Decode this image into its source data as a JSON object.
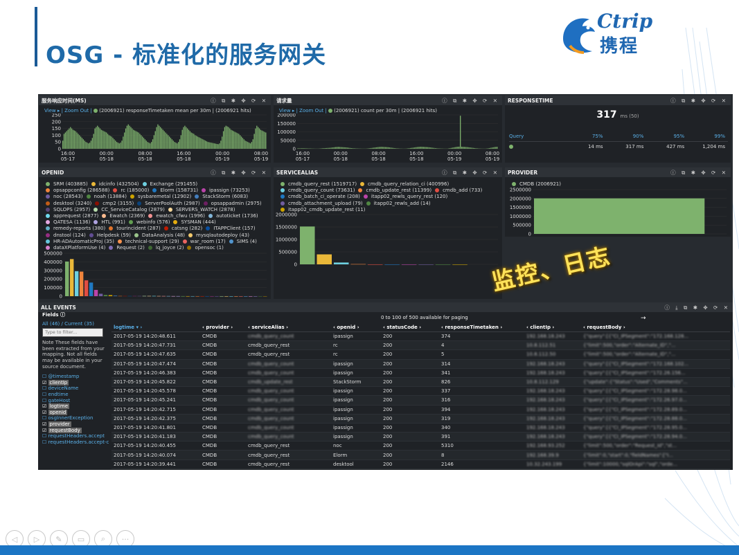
{
  "slide": {
    "title": "OSG - 标准化的服务网关",
    "logo_en": "Ctrip",
    "logo_cn": "携程",
    "overlay": "监控、日志",
    "nav_buttons": [
      "prev",
      "next",
      "pen",
      "screen",
      "zoom",
      "more"
    ]
  },
  "panels": {
    "rt_chart": {
      "title": "服务响应时间(MS)",
      "view": "View ▸ |",
      "zoom": "Zoom Out |",
      "info": "(2006921) responseTimetaken mean per 30m | (2006921 hits)"
    },
    "req_chart": {
      "title": "请求量",
      "view": "View ▸ |",
      "zoom": "Zoom Out |",
      "info": "(2006921) count per 30m | (2006921 hits)"
    },
    "responsetime": {
      "title": "RESPONSETIME",
      "value": "317",
      "unit": "ms (50)",
      "headers": [
        "Query",
        "75%",
        "90%",
        "95%",
        "99%"
      ],
      "values": [
        "14 ms",
        "317 ms",
        "427 ms",
        "1,204 ms"
      ]
    },
    "openid": {
      "title": "OPENID"
    },
    "servicealias": {
      "title": "SERVICEALIAS"
    },
    "provider": {
      "title": "PROVIDER",
      "legend": "CMDB (2006921)"
    },
    "events": {
      "title": "ALL EVENTS",
      "fields_label": "Fields",
      "fields_all": "All (46) / Current (35)",
      "filter_placeholder": "Type to filter...",
      "note": "Note These fields have been extracted from your mapping. Not all fields may be available in your source document.",
      "paging": "0 to 100 of 500 available for paging",
      "arrow": "→"
    }
  },
  "chart_data": [
    {
      "type": "bar",
      "title": "服务响应时间(MS)",
      "x_ticks": [
        "16:00\n05-17",
        "00:00\n05-18",
        "08:00\n05-18",
        "16:00\n05-18",
        "00:00\n05-19",
        "08:00\n05-19"
      ],
      "ylim": [
        0,
        250
      ],
      "y_ticks": [
        0,
        50,
        100,
        150,
        200,
        250
      ],
      "values": [
        60,
        110,
        120,
        130,
        140,
        150,
        160,
        150,
        140,
        135,
        130,
        120,
        110,
        100,
        90,
        80,
        70,
        60,
        50,
        45,
        40,
        45,
        60,
        80,
        110,
        150,
        160,
        170,
        160,
        150,
        140,
        135,
        130,
        125,
        120,
        110,
        100,
        95,
        90,
        80,
        70,
        60,
        50,
        45,
        40,
        45,
        60,
        90,
        120,
        150,
        170,
        180,
        170,
        160,
        150,
        140,
        135,
        130,
        125,
        120,
        110,
        100,
        90,
        80,
        70,
        60,
        50,
        45,
        40,
        50,
        70,
        100,
        130,
        160,
        180,
        170,
        160,
        150,
        140,
        130,
        120,
        110,
        100,
        90,
        80,
        70,
        60,
        50,
        45,
        40,
        50,
        70,
        100,
        140,
        160,
        170,
        160,
        150,
        140,
        130,
        120,
        115,
        110,
        100,
        95,
        90,
        85,
        80,
        75,
        70,
        65,
        60,
        55,
        50,
        48,
        46,
        44,
        42,
        40,
        38,
        36,
        34,
        40,
        60,
        90,
        130,
        160,
        170,
        165,
        160,
        150,
        140,
        135,
        130,
        125,
        120,
        115,
        110,
        100,
        90,
        80,
        70,
        60,
        55,
        50,
        45,
        40,
        50,
        70,
        110,
        150,
        170,
        160,
        150,
        140,
        135,
        130,
        125,
        120
      ]
    },
    {
      "type": "bar",
      "title": "请求量",
      "x_ticks": [
        "16:00\n05-17",
        "00:00\n05-18",
        "08:00\n05-18",
        "16:00\n05-18",
        "00:00\n05-19",
        "08:00\n05-19"
      ],
      "ylim": [
        0,
        200000
      ],
      "y_ticks": [
        0,
        50000,
        100000,
        150000,
        200000
      ],
      "values": [
        2000,
        3000,
        2500,
        3000,
        3500,
        3000,
        2800,
        2500,
        2200,
        2000,
        1800,
        1500,
        1200,
        1000,
        900,
        800,
        1000,
        1500,
        2500,
        3000,
        3500,
        4000,
        4500,
        5000,
        5500,
        6000,
        7000,
        8000,
        9000,
        10000,
        10500,
        11000,
        10500,
        10000,
        9500,
        9000,
        8500,
        8000,
        7000,
        6000,
        5000,
        4000,
        3500,
        3000,
        2500,
        2000,
        1800,
        1500,
        1200,
        1000,
        900,
        800,
        1000,
        1500,
        2500,
        3500,
        4500,
        5500,
        6500,
        7500,
        8500,
        9500,
        10500,
        11000,
        11500,
        11000,
        10500,
        10000,
        9500,
        9000,
        8000,
        7000,
        6000,
        5000,
        4000,
        3000,
        2500,
        2000,
        1500,
        1200,
        1000,
        900,
        1000,
        1500,
        2500,
        3500,
        4500,
        5500,
        6500,
        7500,
        9000,
        10000,
        11000,
        11500,
        12000,
        11500,
        11000,
        10500,
        10000,
        9500,
        9000,
        8000,
        7000,
        6000,
        5000,
        4000,
        3000,
        2500,
        2000,
        1800,
        1500,
        1200,
        1000,
        900,
        1000,
        2000,
        3500,
        5000,
        6500,
        8000,
        9500,
        11000,
        12000,
        12500,
        195000,
        12000,
        11500,
        11000,
        10500,
        10000,
        9000,
        8000,
        7000,
        6000,
        5000,
        4000,
        3000,
        2500,
        2000,
        1500,
        1200,
        1000,
        900,
        1000,
        1500,
        2500,
        4000,
        5500,
        7000,
        8500,
        10000,
        11000,
        11500
      ]
    },
    {
      "type": "bar",
      "title": "OPENID",
      "ylim": [
        0,
        500000
      ],
      "y_ticks": [
        0,
        100000,
        200000,
        300000,
        400000,
        500000
      ],
      "series": [
        {
          "name": "SRM",
          "values": [
            403885
          ],
          "color": "#7eb26d"
        },
        {
          "name": "idcinfo",
          "values": [
            432504
          ],
          "color": "#eab839"
        },
        {
          "name": "Exchange",
          "values": [
            291455
          ],
          "color": "#6ed0e0"
        },
        {
          "name": "opsappconfig",
          "values": [
            286588
          ],
          "color": "#ef843c"
        },
        {
          "name": "rc",
          "values": [
            185000
          ],
          "color": "#e24d42"
        },
        {
          "name": "Elorm",
          "values": [
            158731
          ],
          "color": "#1f78c1"
        },
        {
          "name": "ipassign",
          "values": [
            73253
          ],
          "color": "#ba43a9"
        },
        {
          "name": "noc",
          "values": [
            28543
          ],
          "color": "#705da0"
        },
        {
          "name": "noah",
          "values": [
            13884
          ],
          "color": "#508642"
        },
        {
          "name": "sysbaremetal",
          "values": [
            12902
          ],
          "color": "#cca300"
        },
        {
          "name": "StackStorm",
          "values": [
            6083
          ],
          "color": "#447ebc"
        },
        {
          "name": "desktool",
          "values": [
            3240
          ],
          "color": "#c15c17"
        },
        {
          "name": "cmp2",
          "values": [
            3155
          ],
          "color": "#890f02"
        },
        {
          "name": "ServerPoolAuth",
          "values": [
            2987
          ],
          "color": "#0a437c"
        },
        {
          "name": "opsappadmin",
          "values": [
            2975
          ],
          "color": "#6d1f62"
        },
        {
          "name": "SQLOPS",
          "values": [
            2957
          ],
          "color": "#584477"
        },
        {
          "name": "CC_ServiceCatalog",
          "values": [
            2879
          ],
          "color": "#b7dbab"
        },
        {
          "name": "SERVERS_WATCH",
          "values": [
            2878
          ],
          "color": "#f4d598"
        },
        {
          "name": "apprequest",
          "values": [
            2877
          ],
          "color": "#70dbed"
        },
        {
          "name": "Ewatch",
          "values": [
            2369
          ],
          "color": "#f9ba8f"
        },
        {
          "name": "ewatch_cfwu",
          "values": [
            1996
          ],
          "color": "#f29191"
        },
        {
          "name": "autoticket",
          "values": [
            1736
          ],
          "color": "#82b5d8"
        },
        {
          "name": "QATESA",
          "values": [
            1136
          ],
          "color": "#e5a8e2"
        },
        {
          "name": "HTL",
          "values": [
            991
          ],
          "color": "#aea2e0"
        },
        {
          "name": "webinfo",
          "values": [
            576
          ],
          "color": "#629e51"
        },
        {
          "name": "SYSMAN",
          "values": [
            444
          ],
          "color": "#e5ac0e"
        },
        {
          "name": "remedy-reports",
          "values": [
            380
          ],
          "color": "#64b0c8"
        },
        {
          "name": "tourincident",
          "values": [
            287
          ],
          "color": "#e0752d"
        },
        {
          "name": "catsng",
          "values": [
            282
          ],
          "color": "#bf1b00"
        },
        {
          "name": "ITAPPClient",
          "values": [
            157
          ],
          "color": "#0a50a1"
        },
        {
          "name": "dnstool",
          "values": [
            124
          ],
          "color": "#962d82"
        },
        {
          "name": "Helpdesk",
          "values": [
            59
          ],
          "color": "#614d93"
        },
        {
          "name": "DataAnalysis",
          "values": [
            48
          ],
          "color": "#9ac48a"
        },
        {
          "name": "mysqlautodeploy",
          "values": [
            43
          ],
          "color": "#f2c96d"
        },
        {
          "name": "HR-ADAutomaticProj",
          "values": [
            35
          ],
          "color": "#65c5db"
        },
        {
          "name": "technical-support",
          "values": [
            29
          ],
          "color": "#f9934e"
        },
        {
          "name": "war_room",
          "values": [
            17
          ],
          "color": "#ea6460"
        },
        {
          "name": "SIMS",
          "values": [
            4
          ],
          "color": "#5195ce"
        },
        {
          "name": "dataXPlatformUse",
          "values": [
            4
          ],
          "color": "#d683ce"
        },
        {
          "name": "Request",
          "values": [
            2
          ],
          "color": "#806eb7"
        },
        {
          "name": "lq_joyce",
          "values": [
            2
          ],
          "color": "#3f6833"
        },
        {
          "name": "opensoc",
          "values": [
            1
          ],
          "color": "#967302"
        }
      ]
    },
    {
      "type": "bar",
      "title": "SERVICEALIAS",
      "ylim": [
        0,
        2000000
      ],
      "y_ticks": [
        0,
        500000,
        1000000,
        1500000,
        2000000
      ],
      "series": [
        {
          "name": "cmdb_query_rest",
          "values": [
            1519717
          ],
          "color": "#7eb26d"
        },
        {
          "name": "cmdb_query_relation_ci",
          "values": [
            400996
          ],
          "color": "#eab839"
        },
        {
          "name": "cmdb_query_count",
          "values": [
            73631
          ],
          "color": "#6ed0e0"
        },
        {
          "name": "cmdb_update_rest",
          "values": [
            11399
          ],
          "color": "#ef843c"
        },
        {
          "name": "cmdb_add",
          "values": [
            733
          ],
          "color": "#e24d42"
        },
        {
          "name": "cmdb_batch_ci_operate",
          "values": [
            208
          ],
          "color": "#1f78c1"
        },
        {
          "name": "itapp02_rewls_query_rest",
          "values": [
            120
          ],
          "color": "#ba43a9"
        },
        {
          "name": "cmdb_attachment_upload",
          "values": [
            79
          ],
          "color": "#705da0"
        },
        {
          "name": "itapp02_rewls_add",
          "values": [
            14
          ],
          "color": "#508642"
        },
        {
          "name": "itapp02_cmdb_update_rest",
          "values": [
            11
          ],
          "color": "#cca300"
        }
      ]
    },
    {
      "type": "bar",
      "title": "PROVIDER",
      "ylim": [
        0,
        2500000
      ],
      "y_ticks": [
        0,
        500000,
        1000000,
        1500000,
        2000000,
        2500000
      ],
      "series": [
        {
          "name": "CMDB",
          "values": [
            2006921
          ],
          "color": "#7eb26d"
        }
      ]
    },
    {
      "type": "table",
      "title": "ALL EVENTS",
      "columns": [
        "logtime",
        "provider",
        "serviceAlias",
        "openid",
        "statusCode",
        "responseTimetaken",
        "clientIp",
        "requestBody"
      ],
      "rows": [
        [
          "2017-05-19 14:20:48.611",
          "CMDB",
          "cmdb_query_count",
          "ipassign",
          "200",
          "374",
          "192.168.18.243",
          "{\"query\":[{\"CI_IPSegment\":\"172.168.128..."
        ],
        [
          "2017-05-19 14:20:47.731",
          "CMDB",
          "cmdb_query_rest",
          "rc",
          "200",
          "4",
          "10.8.112.51",
          "{\"limit\":500,\"order\":\"Alternate_ID\",\"..."
        ],
        [
          "2017-05-19 14:20:47.635",
          "CMDB",
          "cmdb_query_rest",
          "rc",
          "200",
          "5",
          "10.8.112.50",
          "{\"limit\":500,\"order\":\"Alternate_ID\",\"..."
        ],
        [
          "2017-05-19 14:20:47.474",
          "CMDB",
          "cmdb_query_count",
          "ipassign",
          "200",
          "314",
          "192.168.18.243",
          "{\"query\":[{\"CI_IPSegment\":\"172.168.102..."
        ],
        [
          "2017-05-19 14:20:46.383",
          "CMDB",
          "cmdb_query_count",
          "ipassign",
          "200",
          "341",
          "192.168.18.243",
          "{\"query\":[{\"CI_IPSegment\":\"172.26.156..."
        ],
        [
          "2017-05-19 14:20:45.822",
          "CMDB",
          "cmdb_update_rest",
          "StackStorm",
          "200",
          "826",
          "10.8.112.129",
          "{\"update\":{\"Status\":\"Used\",\"Comments\"..."
        ],
        [
          "2017-05-19 14:20:45.578",
          "CMDB",
          "cmdb_query_count",
          "ipassign",
          "200",
          "337",
          "192.168.18.243",
          "{\"query\":[{\"CI_IPSegment\":\"172.28.98.0..."
        ],
        [
          "2017-05-19 14:20:45.241",
          "CMDB",
          "cmdb_query_count",
          "ipassign",
          "200",
          "316",
          "192.168.18.243",
          "{\"query\":[{\"CI_IPSegment\":\"172.26.97.0..."
        ],
        [
          "2017-05-19 14:20:42.715",
          "CMDB",
          "cmdb_query_count",
          "ipassign",
          "200",
          "394",
          "192.168.18.243",
          "{\"query\":[{\"CI_IPSegment\":\"172.28.89.0..."
        ],
        [
          "2017-05-19 14:20:42.375",
          "CMDB",
          "cmdb_query_count",
          "ipassign",
          "200",
          "319",
          "192.168.18.243",
          "{\"query\":[{\"CI_IPSegment\":\"172.28.88.0..."
        ],
        [
          "2017-05-19 14:20:41.801",
          "CMDB",
          "cmdb_query_count",
          "ipassign",
          "200",
          "340",
          "192.168.18.243",
          "{\"query\":[{\"CI_IPSegment\":\"172.28.95.0..."
        ],
        [
          "2017-05-19 14:20:41.183",
          "CMDB",
          "cmdb_query_count",
          "ipassign",
          "200",
          "391",
          "192.168.18.243",
          "{\"query\":[{\"CI_IPSegment\":\"172.28.94.0..."
        ],
        [
          "2017-05-19 14:20:40.455",
          "CMDB",
          "cmdb_query_rest",
          "noc",
          "200",
          "5310",
          "192.168.93.252",
          "{\"limit\":500,\"order\":\"Request_Id\",\"st..."
        ],
        [
          "2017-05-19 14:20:40.074",
          "CMDB",
          "cmdb_query_rest",
          "Elorm",
          "200",
          "8",
          "192.168.39.9",
          "{\"limit\":0,\"start\":0,\"fieldNames\":[\"I..."
        ],
        [
          "2017-05-19 14:20:39.441",
          "CMDB",
          "cmdb_query_rest",
          "desktool",
          "200",
          "2146",
          "10.32.243.199",
          "{\"limit\":10000,\"sqlOrApi\":\"sql\",\"orde..."
        ]
      ]
    }
  ],
  "fields": [
    {
      "name": "@timestamp",
      "selected": false
    },
    {
      "name": "clientIp",
      "selected": true
    },
    {
      "name": "deviceName",
      "selected": false
    },
    {
      "name": "endtime",
      "selected": false
    },
    {
      "name": "gateHost",
      "selected": false
    },
    {
      "name": "logtime",
      "selected": true
    },
    {
      "name": "openid",
      "selected": true
    },
    {
      "name": "osgInnerException",
      "selected": false
    },
    {
      "name": "provider",
      "selected": true
    },
    {
      "name": "requestBody",
      "selected": true
    },
    {
      "name": "requestHeaders.accept",
      "selected": false
    },
    {
      "name": "requestHeaders.accept-charset",
      "selected": false
    }
  ]
}
